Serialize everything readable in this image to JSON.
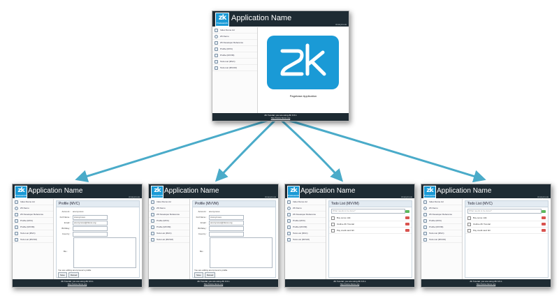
{
  "app": {
    "logo_text": "zk",
    "logo_sub": "Framework",
    "title": "Application Name",
    "user": "Anonymous"
  },
  "sidebar": {
    "items": [
      {
        "label": "Index Demo.zul",
        "icon": "house-icon"
      },
      {
        "label": "ZK Demo",
        "icon": "globe-icon"
      },
      {
        "label": "ZK Developer Reference",
        "icon": "book-icon"
      },
      {
        "label": "Profile (MVC)",
        "icon": "page-icon"
      },
      {
        "label": "Profile (MVVM)",
        "icon": "page-icon"
      },
      {
        "label": "Todo List (MVC)",
        "icon": "page-icon"
      },
      {
        "label": "Todo List (MVVM)",
        "icon": "page-icon"
      }
    ]
  },
  "footer": {
    "line1": "ZK Tutorial, you are using ZK 6.5.1",
    "line2": "http://www.zkoss.org"
  },
  "main_page": {
    "caption": "Pagebase Application"
  },
  "profile_mvc": {
    "title": "Profile (MVC)",
    "fields": [
      {
        "label": "Account :",
        "value": "anonymous"
      },
      {
        "label": "Full Name :",
        "value": "Anonymous"
      },
      {
        "label": "Email :",
        "value": "anonymous@zkoss.org"
      },
      {
        "label": "Birthday :",
        "value": ""
      },
      {
        "label": "Country :",
        "value": ""
      }
    ],
    "bio_label": "Bio :",
    "note": "You are editing anonymous's profile",
    "save": "Save",
    "reload": "Reload"
  },
  "profile_mvvm": {
    "title": "Profile (MVVM)",
    "fields": [
      {
        "label": "Account :",
        "value": "anonymous"
      },
      {
        "label": "Full Name :",
        "value": "Anonymous"
      },
      {
        "label": "Email :",
        "value": "anonymous@zkoss.org"
      },
      {
        "label": "Birthday :",
        "value": ""
      },
      {
        "label": "Country :",
        "value": ""
      }
    ],
    "bio_label": "Bio :",
    "note": "You are editing anonymous's profile",
    "save": "Save",
    "reload": "Reload"
  },
  "todo_mvvm": {
    "title": "Todo List (MVVM)",
    "placeholder": "What needs to be done?",
    "items": [
      "Buy some milk",
      "Outline ZK Tutorial",
      "Pay credit card bill"
    ]
  },
  "todo_mvc": {
    "title": "Todo List (MVC)",
    "placeholder": "What needs to be done?",
    "items": [
      "Buy some milk",
      "Outline ZK Tutorial",
      "Pay credit card bill"
    ]
  },
  "colors": {
    "header": "#1e2b33",
    "brand": "#1a9ad6",
    "arrow": "#4aabc9"
  }
}
